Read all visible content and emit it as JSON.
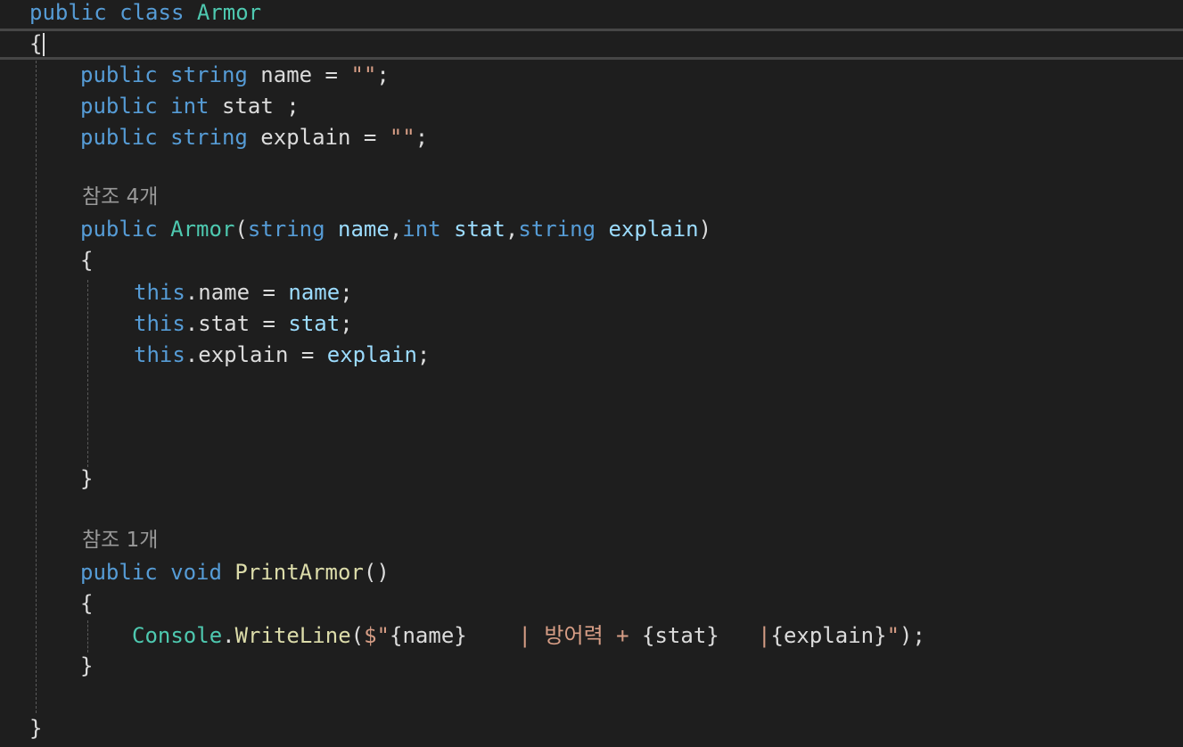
{
  "code": {
    "l1": [
      {
        "t": "public",
        "c": "kw"
      },
      {
        "t": " ",
        "c": "punct"
      },
      {
        "t": "class",
        "c": "kw"
      },
      {
        "t": " ",
        "c": "punct"
      },
      {
        "t": "Armor",
        "c": "type"
      }
    ],
    "l2": [
      {
        "t": "{",
        "c": "punct"
      }
    ],
    "l3": [
      {
        "t": "public",
        "c": "kw"
      },
      {
        "t": " ",
        "c": "punct"
      },
      {
        "t": "string",
        "c": "kw"
      },
      {
        "t": " name = ",
        "c": "ident"
      },
      {
        "t": "\"\"",
        "c": "str"
      },
      {
        "t": ";",
        "c": "punct"
      }
    ],
    "l4": [
      {
        "t": "public",
        "c": "kw"
      },
      {
        "t": " ",
        "c": "punct"
      },
      {
        "t": "int",
        "c": "kw"
      },
      {
        "t": " stat ;",
        "c": "ident"
      }
    ],
    "l5": [
      {
        "t": "public",
        "c": "kw"
      },
      {
        "t": " ",
        "c": "punct"
      },
      {
        "t": "string",
        "c": "kw"
      },
      {
        "t": " explain = ",
        "c": "ident"
      },
      {
        "t": "\"\"",
        "c": "str"
      },
      {
        "t": ";",
        "c": "punct"
      }
    ],
    "lens1": "참조 4개",
    "l6": [
      {
        "t": "public",
        "c": "kw"
      },
      {
        "t": " ",
        "c": "punct"
      },
      {
        "t": "Armor",
        "c": "type"
      },
      {
        "t": "(",
        "c": "punct"
      },
      {
        "t": "string",
        "c": "kw"
      },
      {
        "t": " ",
        "c": "punct"
      },
      {
        "t": "name",
        "c": "param"
      },
      {
        "t": ",",
        "c": "punct"
      },
      {
        "t": "int",
        "c": "kw"
      },
      {
        "t": " ",
        "c": "punct"
      },
      {
        "t": "stat",
        "c": "param"
      },
      {
        "t": ",",
        "c": "punct"
      },
      {
        "t": "string",
        "c": "kw"
      },
      {
        "t": " ",
        "c": "punct"
      },
      {
        "t": "explain",
        "c": "param"
      },
      {
        "t": ")",
        "c": "punct"
      }
    ],
    "l7": [
      {
        "t": "{",
        "c": "punct"
      }
    ],
    "l8": [
      {
        "t": "this",
        "c": "kw"
      },
      {
        "t": ".name = ",
        "c": "ident"
      },
      {
        "t": "name",
        "c": "param"
      },
      {
        "t": ";",
        "c": "punct"
      }
    ],
    "l9": [
      {
        "t": "this",
        "c": "kw"
      },
      {
        "t": ".stat = ",
        "c": "ident"
      },
      {
        "t": "stat",
        "c": "param"
      },
      {
        "t": ";",
        "c": "punct"
      }
    ],
    "l10": [
      {
        "t": "this",
        "c": "kw"
      },
      {
        "t": ".explain = ",
        "c": "ident"
      },
      {
        "t": "explain",
        "c": "param"
      },
      {
        "t": ";",
        "c": "punct"
      }
    ],
    "l11": [
      {
        "t": "}",
        "c": "punct"
      }
    ],
    "lens2": "참조 1개",
    "l12": [
      {
        "t": "public",
        "c": "kw"
      },
      {
        "t": " ",
        "c": "punct"
      },
      {
        "t": "void",
        "c": "kw"
      },
      {
        "t": " ",
        "c": "punct"
      },
      {
        "t": "PrintArmor",
        "c": "method"
      },
      {
        "t": "()",
        "c": "punct"
      }
    ],
    "l13": [
      {
        "t": "{",
        "c": "punct"
      }
    ],
    "l14": [
      {
        "t": "Console",
        "c": "type"
      },
      {
        "t": ".",
        "c": "punct"
      },
      {
        "t": "WriteLine",
        "c": "method"
      },
      {
        "t": "(",
        "c": "punct"
      },
      {
        "t": "$\"",
        "c": "str"
      },
      {
        "t": "{name}",
        "c": "ident"
      },
      {
        "t": "    | 방어력 + ",
        "c": "str"
      },
      {
        "t": "{stat}",
        "c": "ident"
      },
      {
        "t": "   |",
        "c": "str"
      },
      {
        "t": "{explain}",
        "c": "ident"
      },
      {
        "t": "\"",
        "c": "str"
      },
      {
        "t": ");",
        "c": "punct"
      }
    ],
    "l15": [
      {
        "t": "}",
        "c": "punct"
      }
    ],
    "l16": [
      {
        "t": "}",
        "c": "punct"
      }
    ]
  },
  "colors": {
    "background": "#1e1e1e",
    "keyword": "#569cd6",
    "type": "#4ec9b0",
    "method": "#dcdcaa",
    "parameter": "#9cdcfe",
    "string": "#d69d85",
    "codelens": "#999999"
  }
}
